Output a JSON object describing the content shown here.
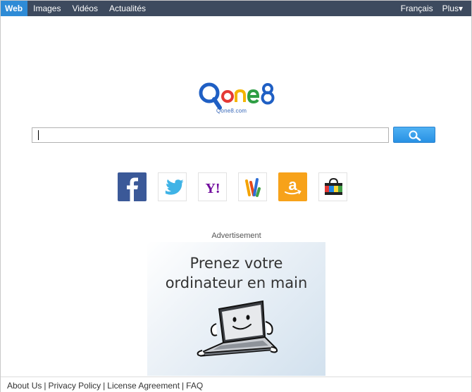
{
  "nav": {
    "items": [
      {
        "label": "Web",
        "active": true
      },
      {
        "label": "Images"
      },
      {
        "label": "Vidéos"
      },
      {
        "label": "Actualités"
      }
    ],
    "language": "Français",
    "more": "Plus▾"
  },
  "logo": {
    "brand": "Qone8",
    "subtext": "Qone8.com"
  },
  "search": {
    "value": "",
    "button_icon": "magnifier-icon"
  },
  "quick_links": [
    {
      "name": "facebook",
      "icon": "facebook-icon",
      "color": "#3b5998"
    },
    {
      "name": "twitter",
      "icon": "twitter-bird-icon",
      "color": "#3fb3e6"
    },
    {
      "name": "yahoo",
      "icon": "yahoo-icon",
      "color": "#720e9e"
    },
    {
      "name": "games",
      "icon": "colorful-stripes-icon",
      "color": "#f4a300"
    },
    {
      "name": "amazon",
      "icon": "amazon-icon",
      "color": "#f7a21a"
    },
    {
      "name": "shopping",
      "icon": "shopping-bag-icon",
      "color": "#e53935"
    }
  ],
  "ad": {
    "label": "Advertisement",
    "line1": "Prenez votre",
    "line2": "ordinateur en main",
    "image": "smiling-laptop-illustration"
  },
  "footer": {
    "links": [
      "About Us",
      "Privacy Policy",
      "License Agreement",
      "FAQ"
    ],
    "separator": "|"
  },
  "colors": {
    "topbar": "#3d4a5e",
    "active_tab": "#2e8bd6",
    "search_button": "#2891e4"
  }
}
